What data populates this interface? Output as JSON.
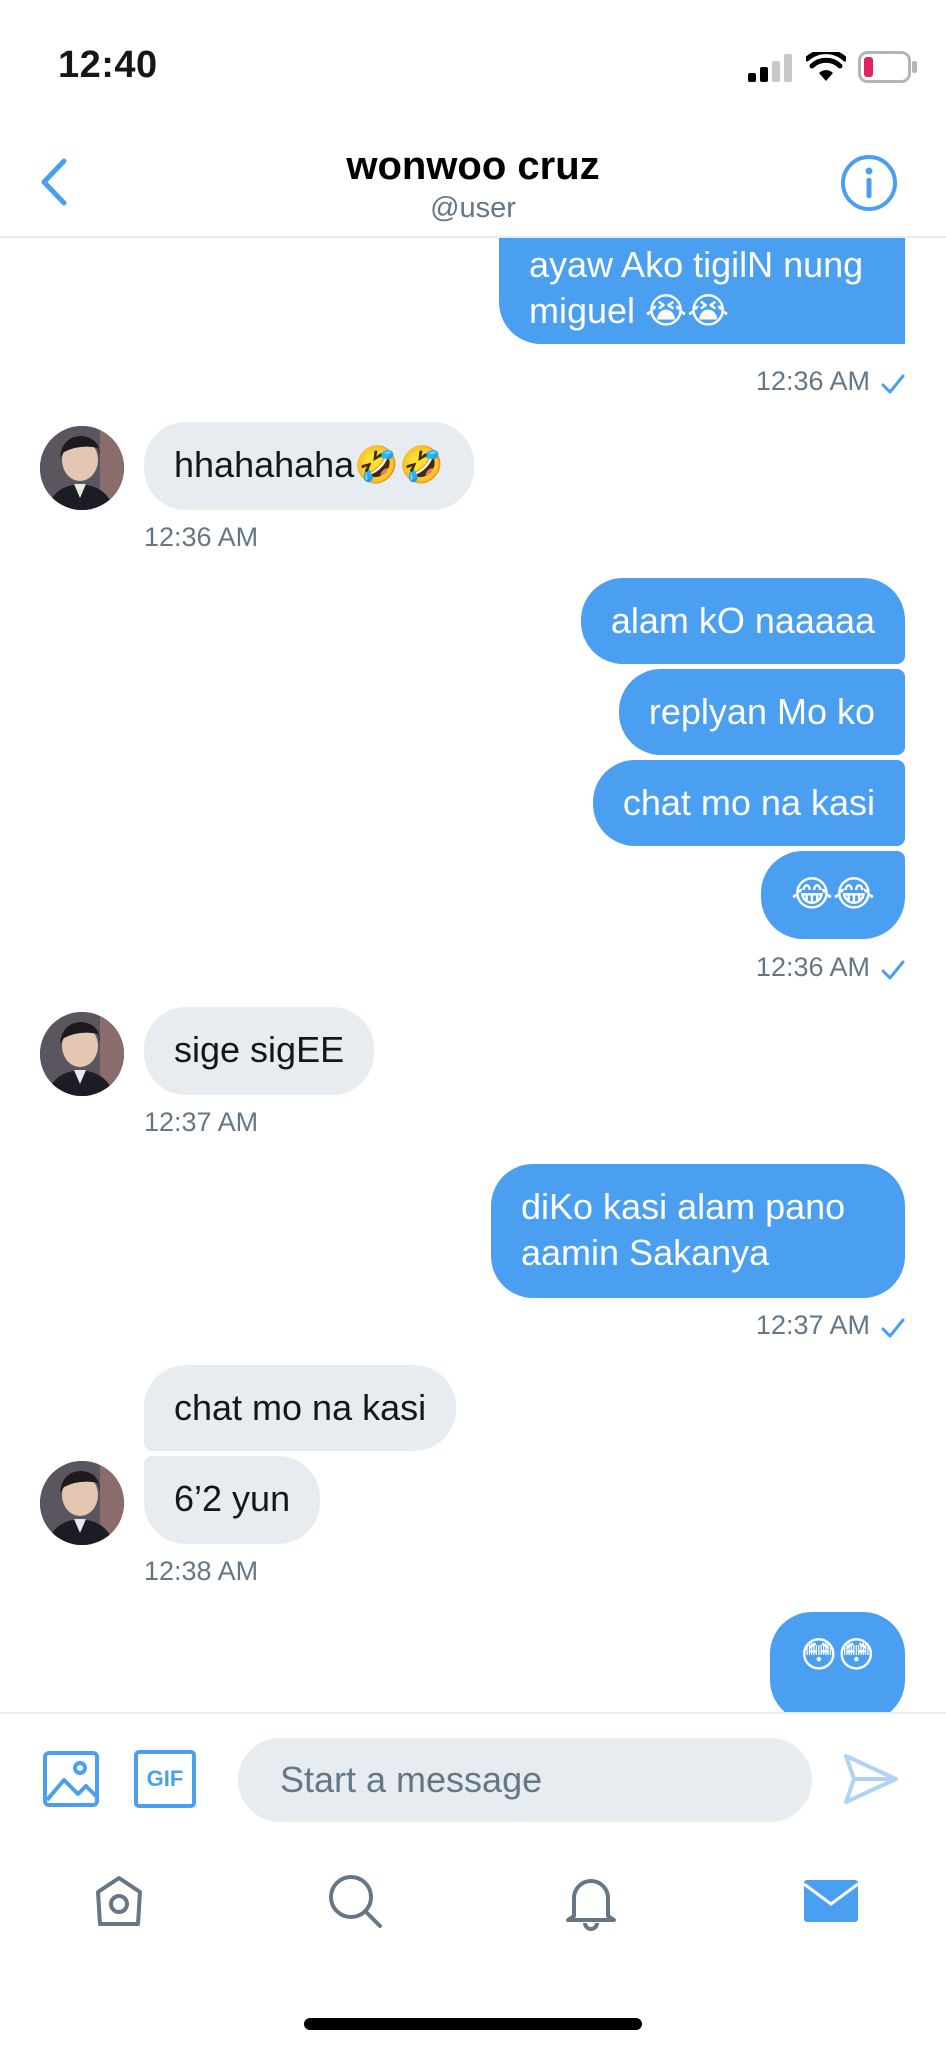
{
  "status_bar": {
    "time": "12:40"
  },
  "header": {
    "title": "wonwoo cruz",
    "username": "@user"
  },
  "messages": [
    {
      "text": "ayaw Ako tigilN nung miguel 😭😭"
    },
    {
      "time": "12:36 AM"
    },
    {
      "text": "hhahahaha🤣🤣"
    },
    {
      "time": "12:36 AM"
    },
    {
      "text": "alam kO naaaaa"
    },
    {
      "text": "replyan Mo ko"
    },
    {
      "text": "chat mo na kasi"
    },
    {
      "text": "😂😂"
    },
    {
      "time": "12:36 AM"
    },
    {
      "text": "sige sigEE"
    },
    {
      "time": "12:37 AM"
    },
    {
      "text": "diKo kasi alam pano aamin Sakanya"
    },
    {
      "time": "12:37 AM"
    },
    {
      "text": "chat mo na kasi"
    },
    {
      "text": "6’2 yun"
    },
    {
      "time": "12:38 AM"
    },
    {
      "text": "😳😳"
    }
  ],
  "composer": {
    "gif_label": "GIF",
    "placeholder": "Start a message"
  },
  "colors": {
    "accent": "#4a9ff0",
    "incoming_bubble": "#e6ecf0",
    "secondary_text": "#657786",
    "battery_low": "#e0245e"
  },
  "icons": [
    "back-chevron-icon",
    "info-icon",
    "image-icon",
    "send-icon",
    "home-icon",
    "search-icon",
    "bell-icon",
    "mail-icon"
  ]
}
